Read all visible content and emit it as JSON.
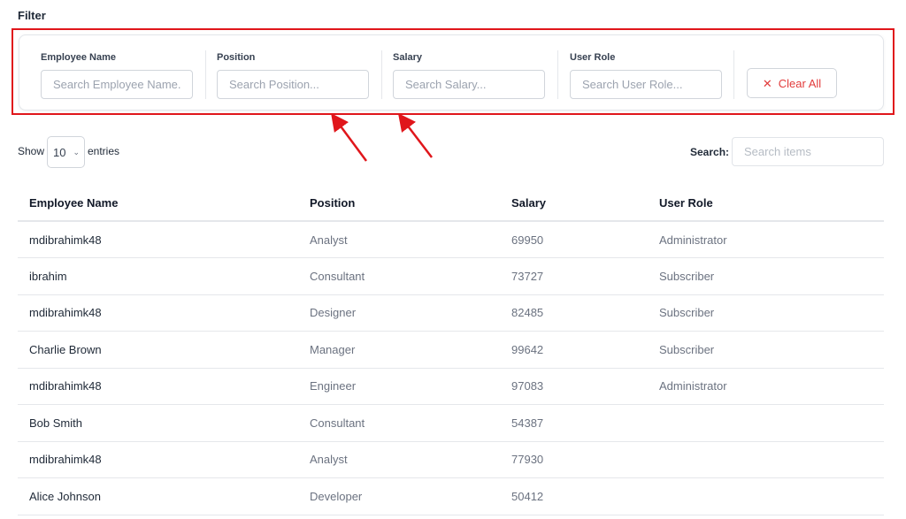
{
  "filter": {
    "title": "Filter",
    "fields": [
      {
        "label": "Employee Name",
        "placeholder": "Search Employee Name..."
      },
      {
        "label": "Position",
        "placeholder": "Search Position..."
      },
      {
        "label": "Salary",
        "placeholder": "Search Salary..."
      },
      {
        "label": "User Role",
        "placeholder": "Search User Role..."
      }
    ],
    "clear_label": "Clear All"
  },
  "controls": {
    "show_label": "Show",
    "entries_value": "10",
    "entries_label": "entries",
    "search_label": "Search:",
    "search_placeholder": "Search items"
  },
  "table": {
    "headers": [
      "Employee Name",
      "Position",
      "Salary",
      "User Role"
    ],
    "rows": [
      [
        "mdibrahimk48",
        "Analyst",
        "69950",
        "Administrator"
      ],
      [
        "ibrahim",
        "Consultant",
        "73727",
        "Subscriber"
      ],
      [
        "mdibrahimk48",
        "Designer",
        "82485",
        "Subscriber"
      ],
      [
        "Charlie Brown",
        "Manager",
        "99642",
        "Subscriber"
      ],
      [
        "mdibrahimk48",
        "Engineer",
        "97083",
        "Administrator"
      ],
      [
        "Bob Smith",
        "Consultant",
        "54387",
        ""
      ],
      [
        "mdibrahimk48",
        "Analyst",
        "77930",
        ""
      ],
      [
        "Alice Johnson",
        "Developer",
        "50412",
        ""
      ]
    ]
  },
  "colors": {
    "annotation_red": "#e0161b",
    "clear_text": "#e23b3b"
  }
}
